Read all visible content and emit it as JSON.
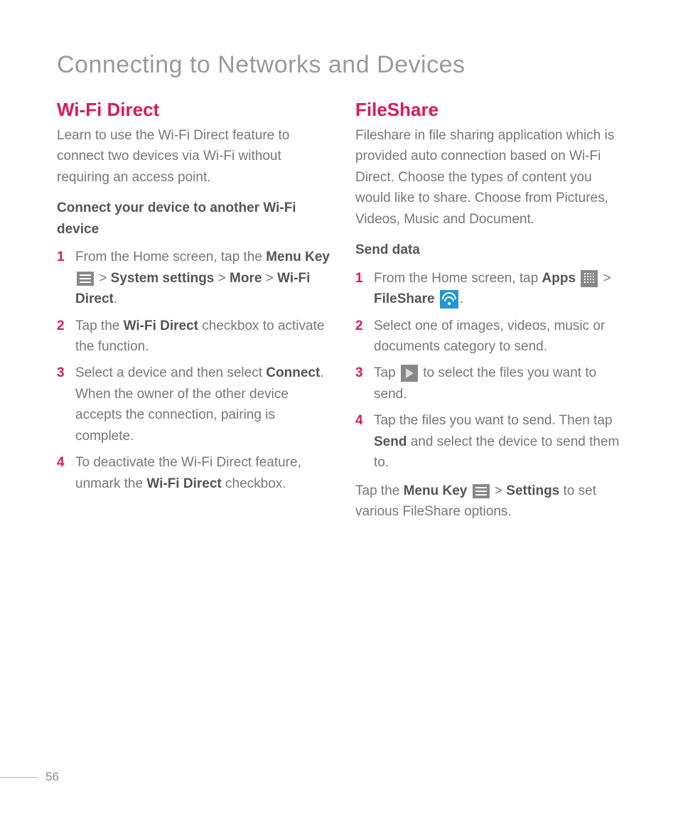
{
  "pageTitle": "Connecting to Networks and Devices",
  "pageNumber": "56",
  "left": {
    "title": "Wi-Fi Direct",
    "intro": "Learn to use the Wi-Fi Direct feature to connect two devices via Wi-Fi without requiring an access point.",
    "subhead": "Connect your device to another Wi-Fi device",
    "steps": {
      "s1a": "From the Home screen, tap the ",
      "s1b": "Menu Key ",
      "s1c": " > ",
      "s1d": "System settings",
      "s1e": " > ",
      "s1f": "More",
      "s1g": " > ",
      "s1h": "Wi-Fi Direct",
      "s1i": ".",
      "s2a": "Tap the ",
      "s2b": "Wi-Fi Direct",
      "s2c": " checkbox to activate the function.",
      "s3a": "Select a device and then select ",
      "s3b": "Connect",
      "s3c": ". When the owner of the other device accepts the connection, pairing is complete.",
      "s4a": "To deactivate the Wi-Fi Direct feature, unmark the ",
      "s4b": "Wi-Fi Direct",
      "s4c": " checkbox."
    }
  },
  "right": {
    "title": "FileShare",
    "intro": "Fileshare in file sharing application which is provided auto connection based on Wi-Fi Direct. Choose the types of content you would like to share. Choose from Pictures, Videos, Music and Document.",
    "subhead": "Send data",
    "steps": {
      "s1a": "From the Home screen, tap ",
      "s1b": "Apps",
      "s1c": " > ",
      "s1d": "FileShare",
      "s1e": ".",
      "s2": "Select one of images, videos, music or documents category to send.",
      "s3a": "Tap ",
      "s3b": " to select the files you want to send.",
      "s4a": "Tap the files you want to send. Then tap ",
      "s4b": "Send",
      "s4c": " and select the device to send them to."
    },
    "tail": {
      "a": "Tap the ",
      "b": "Menu Key ",
      "c": " > ",
      "d": "Settings",
      "e": " to set various FileShare options."
    }
  }
}
